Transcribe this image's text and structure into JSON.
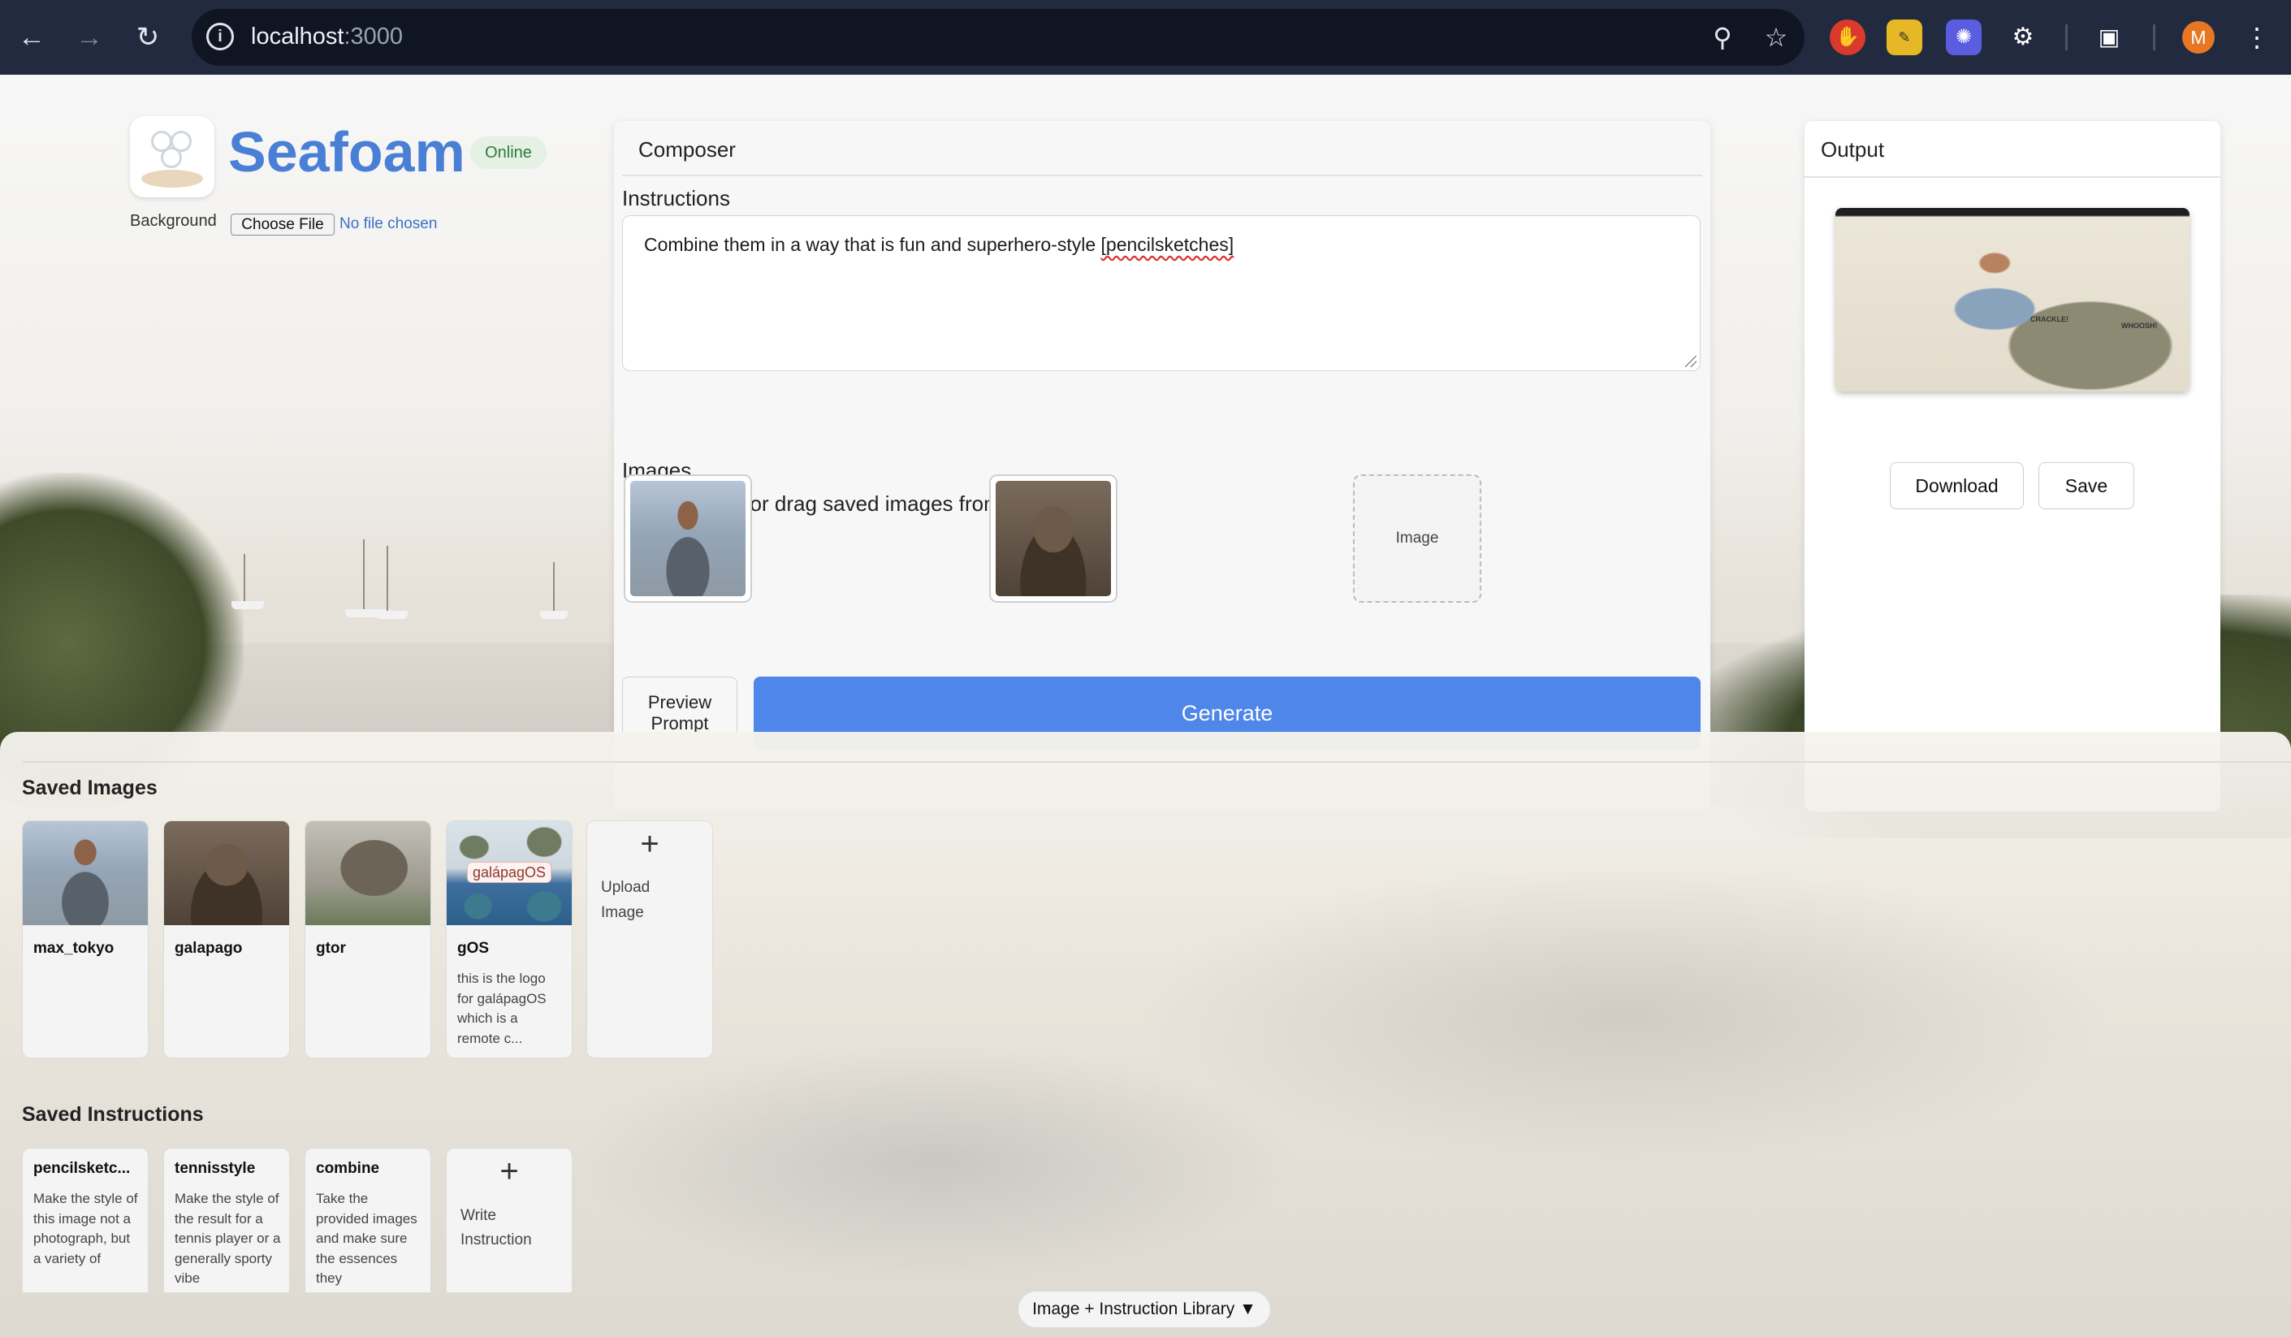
{
  "browser": {
    "url_host": "localhost",
    "url_port": ":3000",
    "avatar_initial": "M"
  },
  "brand": {
    "name": "Seafoam",
    "status": "Online"
  },
  "background": {
    "label": "Background",
    "file_button": "Choose File",
    "file_status": "No file chosen"
  },
  "composer": {
    "title": "Composer",
    "instructions_label": "Instructions",
    "instructions_text": "Combine them in a way that is fun and superhero-style ",
    "instructions_tag": "[pencilsketches]",
    "images_label": "Images",
    "upload_hint": "Upload here (or drag saved images from your library)",
    "empty_slot_label": "Image",
    "preview_line1": "Preview",
    "preview_line2": "Prompt",
    "generate_label": "Generate"
  },
  "output": {
    "title": "Output",
    "download_label": "Download",
    "save_label": "Save",
    "sketch_words": [
      "CRACKLE!",
      "WHOOSH!"
    ]
  },
  "library": {
    "saved_images_heading": "Saved Images",
    "saved_images": [
      {
        "name": "max_tokyo",
        "description": ""
      },
      {
        "name": "galapago",
        "description": ""
      },
      {
        "name": "gtor",
        "description": ""
      },
      {
        "name": "gOS",
        "description": "this is the logo for galápagOS which is a remote c...",
        "overlay": "galápagOS"
      }
    ],
    "upload_line1": "Upload",
    "upload_line2": "Image",
    "saved_instructions_heading": "Saved Instructions",
    "saved_instructions": [
      {
        "name": "pencilsketc...",
        "description": "Make the style of this image not a photograph, but a variety of"
      },
      {
        "name": "tennisstyle",
        "description": "Make the style of the result for a tennis player or a generally sporty vibe"
      },
      {
        "name": "combine",
        "description": "Take the provided images and make sure the essences they"
      }
    ],
    "write_line1": "Write",
    "write_line2": "Instruction",
    "toggle_label": "Image + Instruction Library ▼"
  },
  "colors": {
    "brand": "#4a7fd6",
    "generate": "#4f86ea",
    "status_bg": "#e4f1e4",
    "status_text": "#2f7a3b",
    "chrome": "#212a3e"
  },
  "icons": [
    "back-icon",
    "forward-icon",
    "reload-icon",
    "site-info-icon",
    "zoom-icon",
    "star-icon",
    "extensions-icon",
    "menu-icon",
    "plus-icon"
  ]
}
